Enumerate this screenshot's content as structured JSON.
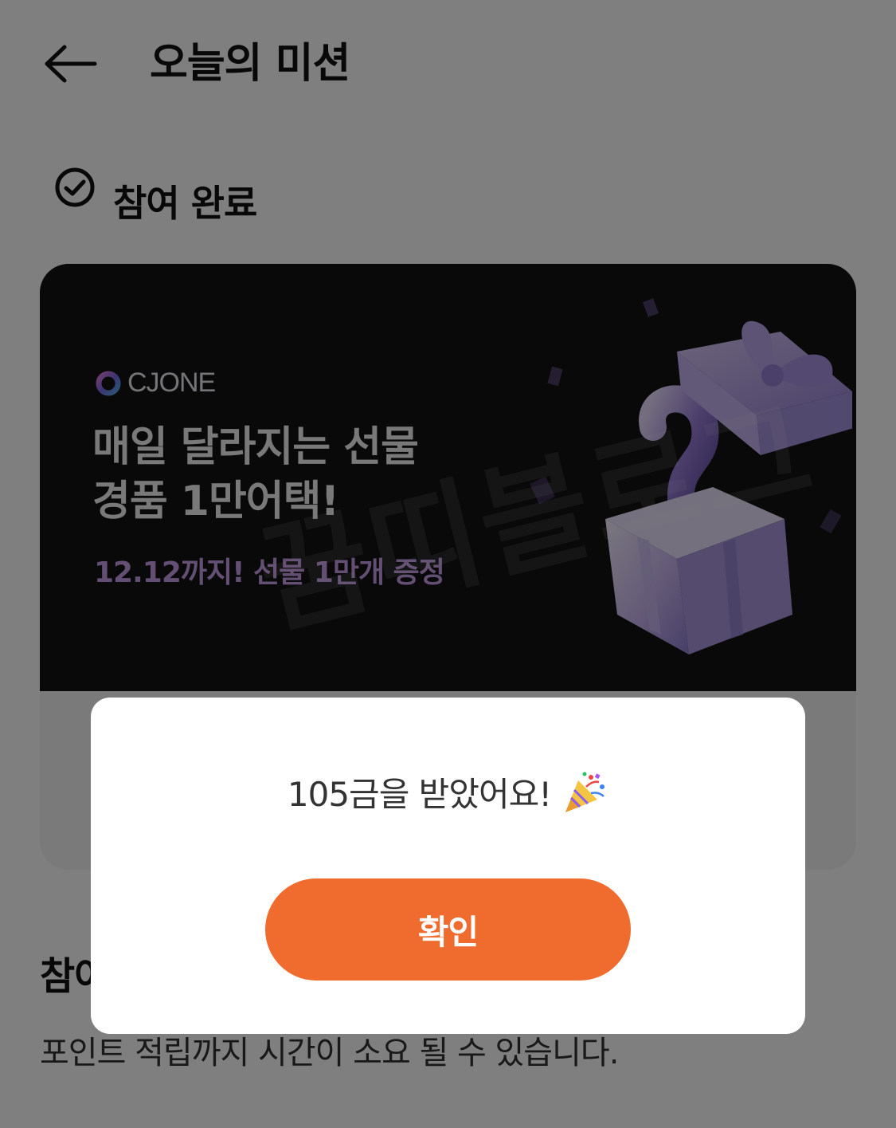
{
  "header": {
    "title": "오늘의 미션",
    "back_icon": "arrow-left-icon"
  },
  "status": {
    "label": "참여 완료",
    "icon": "check-circle-icon"
  },
  "banner": {
    "brand": "CJONE",
    "headline_line1": "매일 달라지는 선물",
    "headline_line2": "경품 1만어택!",
    "subtext": "12.12까지! 선물 1만개 증정",
    "subtext_color": "#c99ee8",
    "background_color": "#121212"
  },
  "watermark": "꿈띠블로그",
  "section": {
    "title": "참여",
    "notice": "포인트 적립까지 시간이 소요 될 수 있습니다."
  },
  "dialog": {
    "message": "105금을 받았어요!",
    "message_icon": "party-popper-icon",
    "confirm_label": "확인",
    "confirm_color": "#ef6b2e"
  }
}
